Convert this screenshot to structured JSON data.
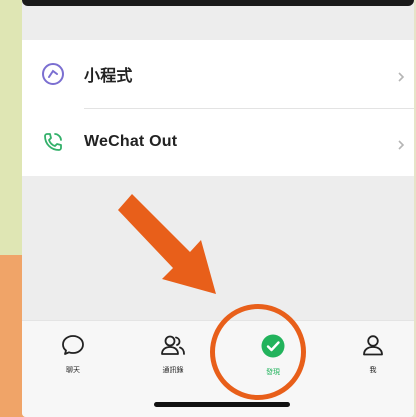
{
  "list": {
    "items": [
      {
        "label": "小程式",
        "icon": "mini-programs-icon"
      },
      {
        "label": "WeChat Out",
        "icon": "phone-icon"
      }
    ]
  },
  "tabbar": {
    "tabs": [
      {
        "label": "聊天",
        "icon": "chat-bubble-icon",
        "active": false
      },
      {
        "label": "通訊錄",
        "icon": "contacts-icon",
        "active": false
      },
      {
        "label": "發現",
        "icon": "discover-compass-icon",
        "active": true
      },
      {
        "label": "我",
        "icon": "profile-icon",
        "active": false
      }
    ]
  },
  "colors": {
    "accent_green": "#22b35c",
    "annotation_orange": "#e85f1a",
    "mini_program_purple": "#7b6fd1"
  }
}
